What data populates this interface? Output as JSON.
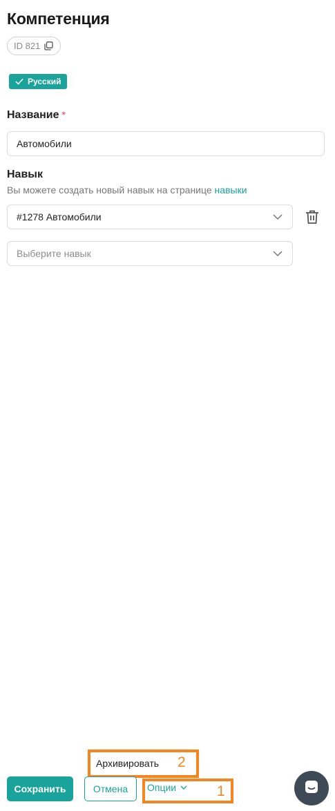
{
  "page": {
    "title": "Компетенция",
    "id_label": "ID 821",
    "language_badge": "Русский"
  },
  "form": {
    "name": {
      "label": "Название",
      "required_mark": "*",
      "value": "Автомобили"
    },
    "skill": {
      "label": "Навык",
      "hint_text": "Вы можете создать новый навык на странице ",
      "hint_link": "навыки",
      "selected_value": "#1278 Автомобили",
      "placeholder": "Выберите навык"
    }
  },
  "footer": {
    "save_label": "Сохранить",
    "cancel_label": "Отмена",
    "options_label": "Опции",
    "options_menu": [
      "Архивировать"
    ]
  },
  "annotations": [
    "1",
    "2"
  ],
  "colors": {
    "accent": "#1aa39a",
    "annotation": "#f5861f",
    "required": "#e04b4b",
    "chat_button": "#3f4a57"
  },
  "icons": {
    "copy": "copy-icon",
    "check": "check-icon",
    "chevron": "chevron-down-icon",
    "delete": "trash-icon",
    "chat": "chat-icon"
  }
}
